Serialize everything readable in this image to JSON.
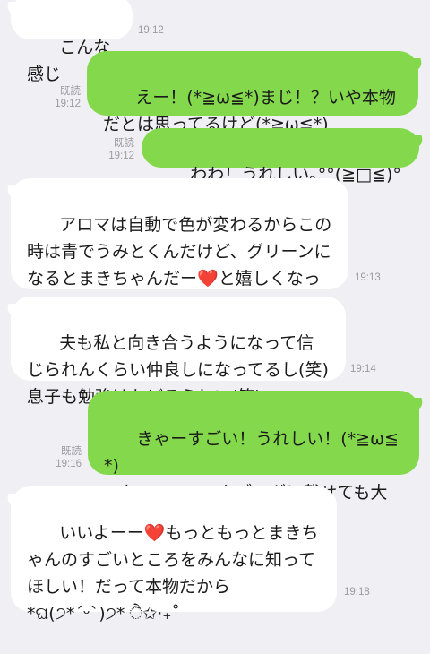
{
  "messages": [
    {
      "side": "in",
      "text": "こんな感じ",
      "time": "19:12"
    },
    {
      "side": "out",
      "text": "えー！(*≧ω≦*)まじ！？いや本物だとは思ってるけど(*≧ω≦*)",
      "read": "既読",
      "time": "19:12"
    },
    {
      "side": "out",
      "text": "わわ！うれしい｡°°(≧□≦)°°｡♡",
      "read": "既読",
      "time": "19:12"
    },
    {
      "side": "in",
      "text_before": "アロマは自動で色が変わるからこの時は青でうみとくんだけど、グリーンになるとまきちゃんだー",
      "heart": "❤️",
      "text_after": "と嬉しくなっちゃう。",
      "time": "19:13"
    },
    {
      "side": "in",
      "text": "夫も私と向き合うようになって信じられんくらい仲良しになってるし(笑)\n息子も勉強はかどるらしい(笑)",
      "time": "19:14"
    },
    {
      "side": "out",
      "text": "きゃーすごい！うれしい！(*≧ω≦*)\nこれFacebookやブログに載せても大丈夫？",
      "read": "既読",
      "time": "19:16"
    },
    {
      "side": "in",
      "text_before": "いいよーー",
      "heart": "❤️",
      "text_after": "もっともっとまきちゃんのすごいところをみんなに知ってほしい！だって本物だから\n*ଘ(੭*ˊᵕˋ)੭* ੈ✩‧₊˚",
      "time": "19:18"
    }
  ]
}
